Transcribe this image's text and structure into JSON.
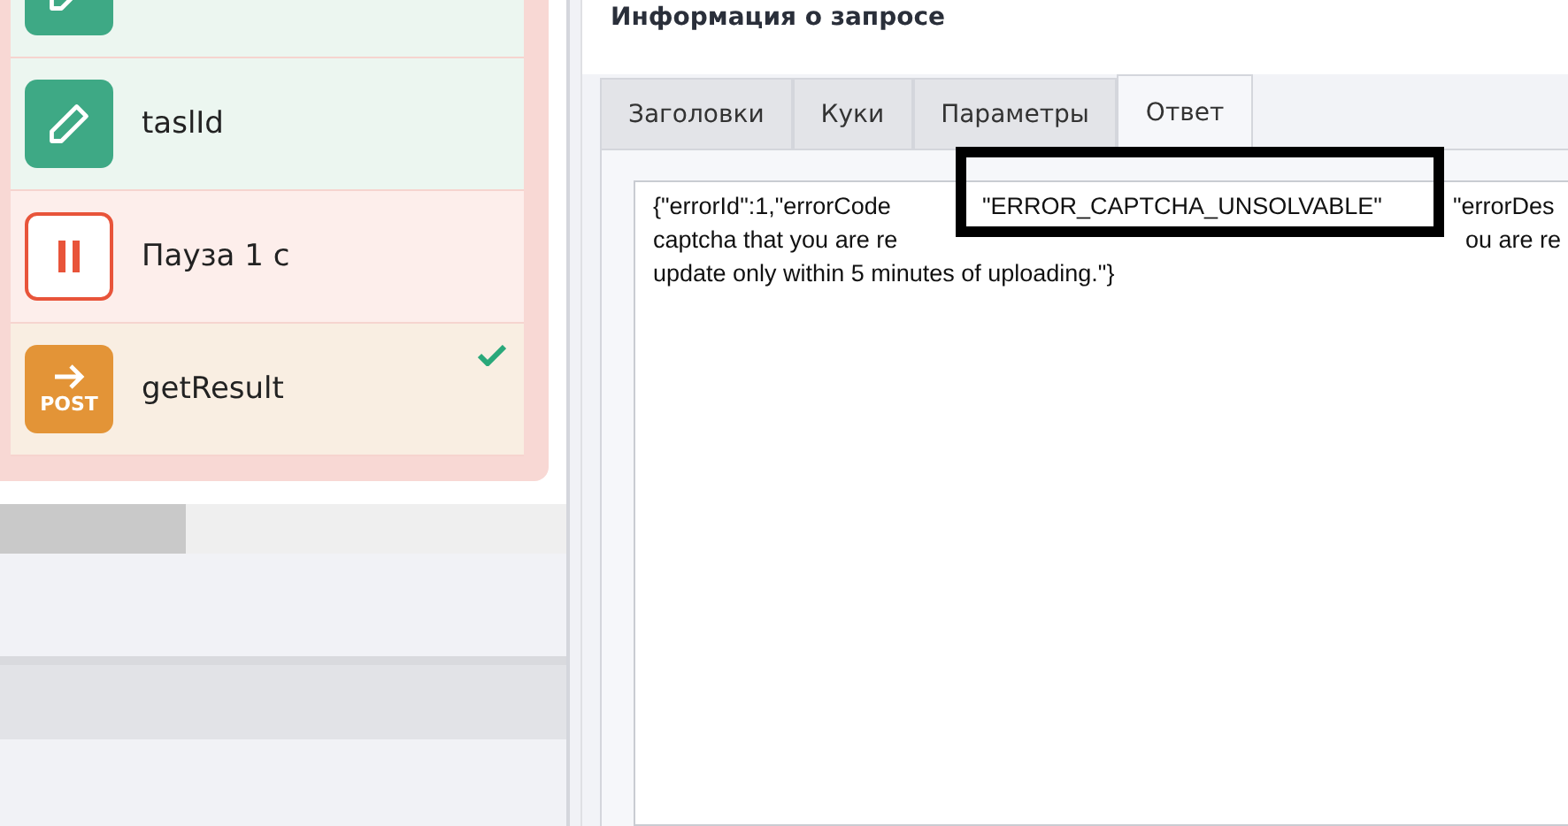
{
  "actions": [
    {
      "kind": "edit",
      "done": false
    },
    {
      "kind": "edit",
      "label": "taslId",
      "done": false
    },
    {
      "kind": "pause",
      "label": "Пауза 1 с",
      "done": false
    },
    {
      "kind": "post",
      "label": "getResult",
      "badge": "POST",
      "done": true
    }
  ],
  "panel": {
    "title": "Информация о запросе",
    "tabs": [
      {
        "label": "Заголовки",
        "selected": false
      },
      {
        "label": "Куки",
        "selected": false
      },
      {
        "label": "Параметры",
        "selected": false
      },
      {
        "label": "Ответ",
        "selected": true
      }
    ],
    "response_lines": [
      [
        "{\"errorId\":1,\"errorCode",
        "\"ERROR_CAPTCHA_UNSOLVABLE\"",
        "\"errorDes"
      ],
      [
        "captcha that you are re",
        "ou are re"
      ],
      [
        "update only within 5 minutes of uploading.\"}"
      ]
    ]
  }
}
